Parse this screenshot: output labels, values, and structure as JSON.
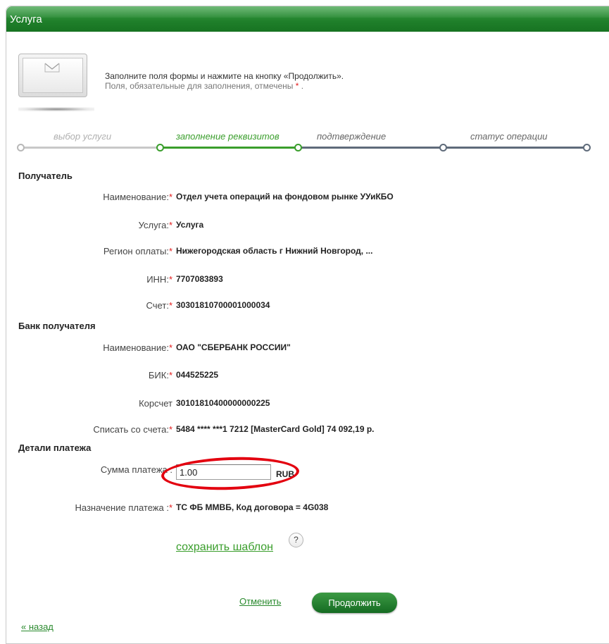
{
  "window": {
    "title": "Услуга"
  },
  "hint": {
    "line1": "Заполните поля формы и нажмите на кнопку «Продолжить».",
    "line2_prefix": "Поля, обязательные для заполнения, отмечены",
    "line2_mark": "*",
    "line2_suffix": "."
  },
  "steps": [
    {
      "label": "выбор услуги",
      "state": "done"
    },
    {
      "label": "заполнение реквизитов",
      "state": "active"
    },
    {
      "label": "подтверждение",
      "state": "pending"
    },
    {
      "label": "статус операции",
      "state": "pending"
    }
  ],
  "recipient": {
    "section_title": "Получатель",
    "name_label": "Наименование:",
    "name_value": "Отдел учета операций на фондовом рынке УУиКБО",
    "service_label": "Услуга:",
    "service_value": "Услуга",
    "region_label": "Регион оплаты:",
    "region_value": "Нижегородская область г Нижний Новгород, ...",
    "inn_label": "ИНН:",
    "inn_value": "7707083893",
    "account_label": "Счет:",
    "account_value": "30301810700001000034"
  },
  "bank": {
    "section_title": "Банк получателя",
    "name_label": "Наименование:",
    "name_value": "ОАО \"СБЕРБАНК РОССИИ\"",
    "bik_label": "БИК:",
    "bik_value": "044525225",
    "corr_label": "Корсчет",
    "corr_value": "30101810400000000225",
    "debit_label": "Списать со счета:",
    "debit_value": "5484 **** ***1 7212  [MasterCard Gold] 74 092,19  р."
  },
  "payment": {
    "section_title": "Детали платежа",
    "amount_label": "Сумма платежа :",
    "amount_value": "1.00",
    "currency": "RUB",
    "purpose_label": "Назначение платежа :",
    "purpose_value": "ТС ФБ ММВБ, Код договора = 4G038"
  },
  "actions": {
    "save_template": "сохранить шаблон",
    "help": "?",
    "cancel": "Отменить",
    "continue": "Продолжить",
    "back": "« назад"
  },
  "colors": {
    "brand_green": "#1f7f2a",
    "required": "#e31b1b",
    "annotation": "#e3000f"
  }
}
